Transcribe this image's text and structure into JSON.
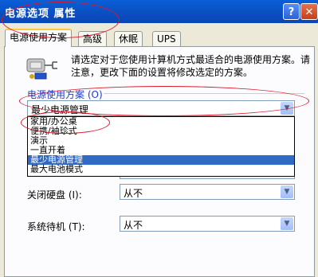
{
  "window": {
    "title": "电源选项 属性",
    "help_glyph": "?",
    "close_glyph": "✕"
  },
  "tabs": [
    {
      "label": "电源使用方案"
    },
    {
      "label": "高级"
    },
    {
      "label": "休眠"
    },
    {
      "label": "UPS"
    }
  ],
  "description": "请选定对于您使用计算机方式最适合的电源使用方案。请注意，更改下面的设置将修改选定的方案。",
  "scheme_group": {
    "label": "电源使用方案 (O)",
    "selected": "最少电源管理",
    "options": [
      "家用/办公桌",
      "便携/袖珍式",
      "演示",
      "一直开着",
      "最少电源管理",
      "最大电池模式"
    ],
    "selected_index": 4
  },
  "settings": [
    {
      "label": "关闭硬盘 (I):",
      "value": "从不"
    },
    {
      "label": "系统待机 (T):",
      "value": "从不"
    }
  ],
  "colors": {
    "annotation": "#d8192c",
    "selection": "#316ac5",
    "titlebar": "#0b50c4"
  }
}
